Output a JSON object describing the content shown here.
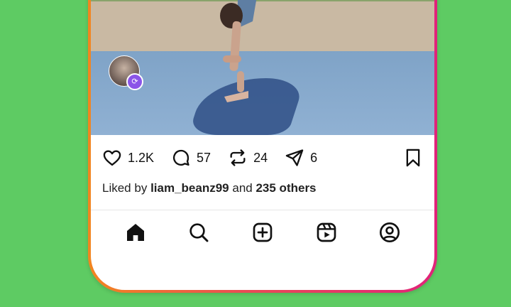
{
  "post": {
    "likes": "1.2K",
    "comments": "57",
    "reposts": "24",
    "shares": "6",
    "liked_by_prefix": "Liked by",
    "liked_by_user": "liam_beanz99",
    "liked_by_and": "and",
    "liked_by_others": "235 others"
  },
  "icons": {
    "like": "heart-icon",
    "comment": "comment-icon",
    "repost": "repost-icon",
    "share": "share-icon",
    "save": "bookmark-icon"
  },
  "nav": [
    "home-icon",
    "search-icon",
    "create-icon",
    "reels-icon",
    "profile-icon"
  ],
  "colors": {
    "background": "#5ecb63",
    "frame_start": "#f2861f",
    "frame_end": "#e0237a",
    "badge": "#8b55e8"
  }
}
